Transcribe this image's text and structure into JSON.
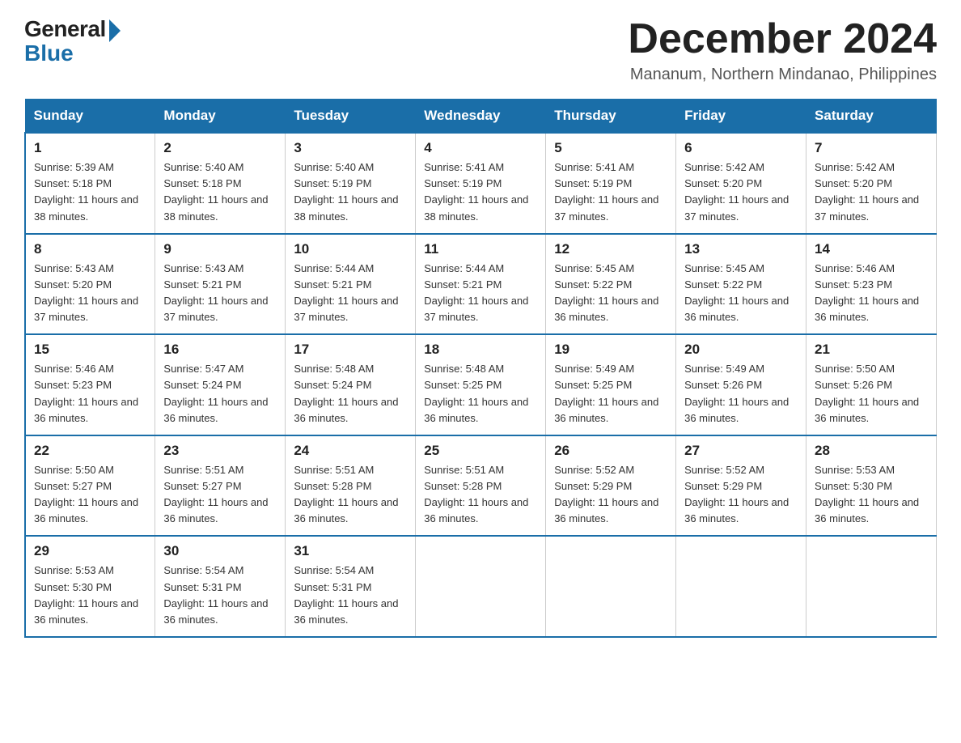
{
  "logo": {
    "general": "General",
    "blue": "Blue"
  },
  "header": {
    "month_year": "December 2024",
    "location": "Mananum, Northern Mindanao, Philippines"
  },
  "days_of_week": [
    "Sunday",
    "Monday",
    "Tuesday",
    "Wednesday",
    "Thursday",
    "Friday",
    "Saturday"
  ],
  "weeks": [
    [
      {
        "day": "1",
        "sunrise": "5:39 AM",
        "sunset": "5:18 PM",
        "daylight": "11 hours and 38 minutes."
      },
      {
        "day": "2",
        "sunrise": "5:40 AM",
        "sunset": "5:18 PM",
        "daylight": "11 hours and 38 minutes."
      },
      {
        "day": "3",
        "sunrise": "5:40 AM",
        "sunset": "5:19 PM",
        "daylight": "11 hours and 38 minutes."
      },
      {
        "day": "4",
        "sunrise": "5:41 AM",
        "sunset": "5:19 PM",
        "daylight": "11 hours and 38 minutes."
      },
      {
        "day": "5",
        "sunrise": "5:41 AM",
        "sunset": "5:19 PM",
        "daylight": "11 hours and 37 minutes."
      },
      {
        "day": "6",
        "sunrise": "5:42 AM",
        "sunset": "5:20 PM",
        "daylight": "11 hours and 37 minutes."
      },
      {
        "day": "7",
        "sunrise": "5:42 AM",
        "sunset": "5:20 PM",
        "daylight": "11 hours and 37 minutes."
      }
    ],
    [
      {
        "day": "8",
        "sunrise": "5:43 AM",
        "sunset": "5:20 PM",
        "daylight": "11 hours and 37 minutes."
      },
      {
        "day": "9",
        "sunrise": "5:43 AM",
        "sunset": "5:21 PM",
        "daylight": "11 hours and 37 minutes."
      },
      {
        "day": "10",
        "sunrise": "5:44 AM",
        "sunset": "5:21 PM",
        "daylight": "11 hours and 37 minutes."
      },
      {
        "day": "11",
        "sunrise": "5:44 AM",
        "sunset": "5:21 PM",
        "daylight": "11 hours and 37 minutes."
      },
      {
        "day": "12",
        "sunrise": "5:45 AM",
        "sunset": "5:22 PM",
        "daylight": "11 hours and 36 minutes."
      },
      {
        "day": "13",
        "sunrise": "5:45 AM",
        "sunset": "5:22 PM",
        "daylight": "11 hours and 36 minutes."
      },
      {
        "day": "14",
        "sunrise": "5:46 AM",
        "sunset": "5:23 PM",
        "daylight": "11 hours and 36 minutes."
      }
    ],
    [
      {
        "day": "15",
        "sunrise": "5:46 AM",
        "sunset": "5:23 PM",
        "daylight": "11 hours and 36 minutes."
      },
      {
        "day": "16",
        "sunrise": "5:47 AM",
        "sunset": "5:24 PM",
        "daylight": "11 hours and 36 minutes."
      },
      {
        "day": "17",
        "sunrise": "5:48 AM",
        "sunset": "5:24 PM",
        "daylight": "11 hours and 36 minutes."
      },
      {
        "day": "18",
        "sunrise": "5:48 AM",
        "sunset": "5:25 PM",
        "daylight": "11 hours and 36 minutes."
      },
      {
        "day": "19",
        "sunrise": "5:49 AM",
        "sunset": "5:25 PM",
        "daylight": "11 hours and 36 minutes."
      },
      {
        "day": "20",
        "sunrise": "5:49 AM",
        "sunset": "5:26 PM",
        "daylight": "11 hours and 36 minutes."
      },
      {
        "day": "21",
        "sunrise": "5:50 AM",
        "sunset": "5:26 PM",
        "daylight": "11 hours and 36 minutes."
      }
    ],
    [
      {
        "day": "22",
        "sunrise": "5:50 AM",
        "sunset": "5:27 PM",
        "daylight": "11 hours and 36 minutes."
      },
      {
        "day": "23",
        "sunrise": "5:51 AM",
        "sunset": "5:27 PM",
        "daylight": "11 hours and 36 minutes."
      },
      {
        "day": "24",
        "sunrise": "5:51 AM",
        "sunset": "5:28 PM",
        "daylight": "11 hours and 36 minutes."
      },
      {
        "day": "25",
        "sunrise": "5:51 AM",
        "sunset": "5:28 PM",
        "daylight": "11 hours and 36 minutes."
      },
      {
        "day": "26",
        "sunrise": "5:52 AM",
        "sunset": "5:29 PM",
        "daylight": "11 hours and 36 minutes."
      },
      {
        "day": "27",
        "sunrise": "5:52 AM",
        "sunset": "5:29 PM",
        "daylight": "11 hours and 36 minutes."
      },
      {
        "day": "28",
        "sunrise": "5:53 AM",
        "sunset": "5:30 PM",
        "daylight": "11 hours and 36 minutes."
      }
    ],
    [
      {
        "day": "29",
        "sunrise": "5:53 AM",
        "sunset": "5:30 PM",
        "daylight": "11 hours and 36 minutes."
      },
      {
        "day": "30",
        "sunrise": "5:54 AM",
        "sunset": "5:31 PM",
        "daylight": "11 hours and 36 minutes."
      },
      {
        "day": "31",
        "sunrise": "5:54 AM",
        "sunset": "5:31 PM",
        "daylight": "11 hours and 36 minutes."
      },
      null,
      null,
      null,
      null
    ]
  ],
  "labels": {
    "sunrise": "Sunrise:",
    "sunset": "Sunset:",
    "daylight": "Daylight:"
  }
}
